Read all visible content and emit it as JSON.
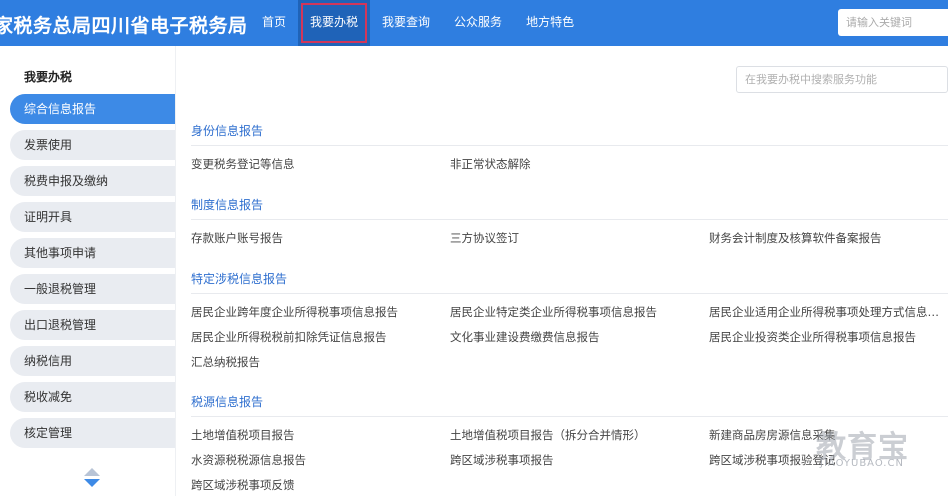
{
  "header": {
    "brand": "家税务总局四川省电子税务局",
    "nav": [
      {
        "label": "首页"
      },
      {
        "label": "我要办税"
      },
      {
        "label": "我要查询"
      },
      {
        "label": "公众服务"
      },
      {
        "label": "地方特色"
      }
    ],
    "active_nav": "我要办税",
    "search_placeholder": "请输入关键词"
  },
  "sidebar": {
    "title": "我要办税",
    "items": [
      {
        "label": "综合信息报告"
      },
      {
        "label": "发票使用"
      },
      {
        "label": "税费申报及缴纳"
      },
      {
        "label": "证明开具"
      },
      {
        "label": "其他事项申请"
      },
      {
        "label": "一般退税管理"
      },
      {
        "label": "出口退税管理"
      },
      {
        "label": "纳税信用"
      },
      {
        "label": "税收减免"
      },
      {
        "label": "核定管理"
      }
    ],
    "active_item": "综合信息报告"
  },
  "main": {
    "search_placeholder": "在我要办税中搜索服务功能",
    "sections": [
      {
        "title": "身份信息报告",
        "links": [
          "变更税务登记等信息",
          "非正常状态解除"
        ]
      },
      {
        "title": "制度信息报告",
        "links": [
          "存款账户账号报告",
          "三方协议签订",
          "财务会计制度及核算软件备案报告"
        ]
      },
      {
        "title": "特定涉税信息报告",
        "links": [
          "居民企业跨年度企业所得税事项信息报告",
          "居民企业特定类企业所得税事项信息报告",
          "居民企业适用企业所得税事项处理方式信息…",
          "居民企业所得税税前扣除凭证信息报告",
          "文化事业建设费缴费信息报告",
          "居民企业投资类企业所得税事项信息报告",
          "汇总纳税报告"
        ]
      },
      {
        "title": "税源信息报告",
        "links": [
          "土地增值税项目报告",
          "土地增值税项目报告（拆分合并情形）",
          "新建商品房房源信息采集",
          "水资源税税源信息报告",
          "跨区域涉税事项报告",
          "跨区域涉税事项报验登记",
          "跨区域涉税事项反馈"
        ]
      }
    ]
  },
  "watermark": {
    "text": "教育宝",
    "sub": "JIAOYUBAO.CN"
  },
  "colors": {
    "header_bg": "#2f7ee0",
    "active_nav_bg": "#1f63b8",
    "active_nav_outline": "#d1365a",
    "sidebar_active": "#3d8ae6",
    "section_title": "#2f6fcf"
  }
}
